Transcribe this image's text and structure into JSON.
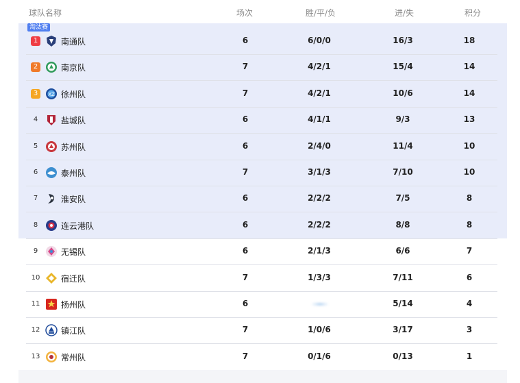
{
  "header": {
    "team": "球队名称",
    "played": "场次",
    "wdl": "胜/平/负",
    "goals": "进/失",
    "points": "积分"
  },
  "section_tag": "淘汰赛",
  "colors": {
    "highlight_band": "#e8ecfa",
    "tag_blue": "#4f7ef0",
    "rank1": "#ef3d44",
    "rank2": "#f07a2a",
    "rank3": "#f5a623"
  },
  "rows": [
    {
      "rank": "1",
      "team": "南通队",
      "played": "6",
      "wdl": "6/0/0",
      "goals": "16/3",
      "points": "18",
      "logo": "nantong-crest-icon"
    },
    {
      "rank": "2",
      "team": "南京队",
      "played": "7",
      "wdl": "4/2/1",
      "goals": "15/4",
      "points": "14",
      "logo": "nanjing-crest-icon"
    },
    {
      "rank": "3",
      "team": "徐州队",
      "played": "7",
      "wdl": "4/2/1",
      "goals": "10/6",
      "points": "14",
      "logo": "xuzhou-crest-icon"
    },
    {
      "rank": "4",
      "team": "盐城队",
      "played": "6",
      "wdl": "4/1/1",
      "goals": "9/3",
      "points": "13",
      "logo": "yancheng-crest-icon"
    },
    {
      "rank": "5",
      "team": "苏州队",
      "played": "6",
      "wdl": "2/4/0",
      "goals": "11/4",
      "points": "10",
      "logo": "suzhou-crest-icon"
    },
    {
      "rank": "6",
      "team": "泰州队",
      "played": "7",
      "wdl": "3/1/3",
      "goals": "7/10",
      "points": "10",
      "logo": "taizhou-crest-icon"
    },
    {
      "rank": "7",
      "team": "淮安队",
      "played": "6",
      "wdl": "2/2/2",
      "goals": "7/5",
      "points": "8",
      "logo": "huaian-crest-icon"
    },
    {
      "rank": "8",
      "team": "连云港队",
      "played": "6",
      "wdl": "2/2/2",
      "goals": "8/8",
      "points": "8",
      "logo": "lianyungang-crest-icon"
    },
    {
      "rank": "9",
      "team": "无锡队",
      "played": "6",
      "wdl": "2/1/3",
      "goals": "6/6",
      "points": "7",
      "logo": "wuxi-crest-icon"
    },
    {
      "rank": "10",
      "team": "宿迁队",
      "played": "7",
      "wdl": "1/3/3",
      "goals": "7/11",
      "points": "6",
      "logo": "suqian-crest-icon"
    },
    {
      "rank": "11",
      "team": "扬州队",
      "played": "6",
      "wdl": "",
      "goals": "5/14",
      "points": "4",
      "logo": "yangzhou-crest-icon"
    },
    {
      "rank": "12",
      "team": "镇江队",
      "played": "7",
      "wdl": "1/0/6",
      "goals": "3/17",
      "points": "3",
      "logo": "zhenjiang-crest-icon"
    },
    {
      "rank": "13",
      "team": "常州队",
      "played": "7",
      "wdl": "0/1/6",
      "goals": "0/13",
      "points": "1",
      "logo": "changzhou-crest-icon"
    }
  ]
}
